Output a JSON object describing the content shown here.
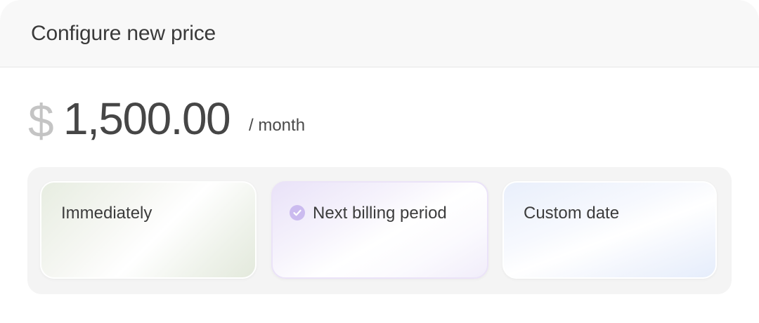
{
  "header": {
    "title": "Configure new price"
  },
  "price": {
    "currency_symbol": "$",
    "amount": "1,500.00",
    "period": "/ month"
  },
  "options": [
    {
      "label": "Immediately",
      "selected": false
    },
    {
      "label": "Next billing period",
      "selected": true
    },
    {
      "label": "Custom date",
      "selected": false
    }
  ],
  "colors": {
    "selected_check": "#cbbbef",
    "immediate_tint": "#e7ede1",
    "next_tint": "#e9e2f8",
    "custom_tint": "#e9effb"
  },
  "icons": {
    "selected_indicator": "check-circle-icon"
  }
}
